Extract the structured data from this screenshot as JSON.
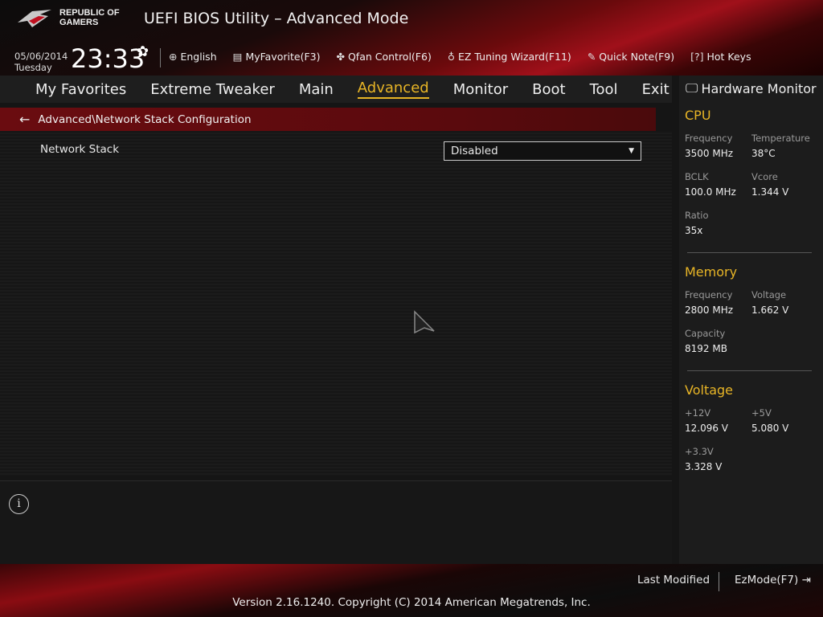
{
  "header": {
    "brand": "REPUBLIC OF GAMERS",
    "title": "UEFI BIOS Utility – Advanced Mode",
    "date": "05/06/2014",
    "day": "Tuesday",
    "time": "23:33"
  },
  "toolbar": [
    {
      "icon": "globe-icon",
      "label": "English"
    },
    {
      "icon": "favorite-list-icon",
      "label": "MyFavorite(F3)"
    },
    {
      "icon": "fan-icon",
      "label": "Qfan Control(F6)"
    },
    {
      "icon": "lightbulb-icon",
      "label": "EZ Tuning Wizard(F11)"
    },
    {
      "icon": "note-icon",
      "label": "Quick Note(F9)"
    },
    {
      "icon": "help-icon",
      "label": "Hot Keys"
    }
  ],
  "nav": {
    "tabs": [
      "My Favorites",
      "Extreme Tweaker",
      "Main",
      "Advanced",
      "Monitor",
      "Boot",
      "Tool",
      "Exit"
    ],
    "active": "Advanced"
  },
  "breadcrumb": "Advanced\\Network Stack Configuration",
  "settings": [
    {
      "label": "Network Stack",
      "value": "Disabled"
    }
  ],
  "hw": {
    "title": "Hardware Monitor",
    "cpu": {
      "title": "CPU",
      "items": [
        {
          "k": "Frequency",
          "v": "3500 MHz"
        },
        {
          "k": "Temperature",
          "v": "38°C"
        },
        {
          "k": "BCLK",
          "v": "100.0 MHz"
        },
        {
          "k": "Vcore",
          "v": "1.344 V"
        },
        {
          "k": "Ratio",
          "v": "35x"
        }
      ]
    },
    "memory": {
      "title": "Memory",
      "items": [
        {
          "k": "Frequency",
          "v": "2800 MHz"
        },
        {
          "k": "Voltage",
          "v": "1.662 V"
        },
        {
          "k": "Capacity",
          "v": "8192 MB"
        }
      ]
    },
    "voltage": {
      "title": "Voltage",
      "items": [
        {
          "k": "+12V",
          "v": "12.096 V"
        },
        {
          "k": "+5V",
          "v": "5.080 V"
        },
        {
          "k": "+3.3V",
          "v": "3.328 V"
        }
      ]
    }
  },
  "footer": {
    "last_modified": "Last Modified",
    "ezmode": "EzMode(F7)",
    "version": "Version 2.16.1240. Copyright (C) 2014 American Megatrends, Inc."
  },
  "colors": {
    "accent": "#e8b526",
    "crumb": "#6a0c10"
  }
}
